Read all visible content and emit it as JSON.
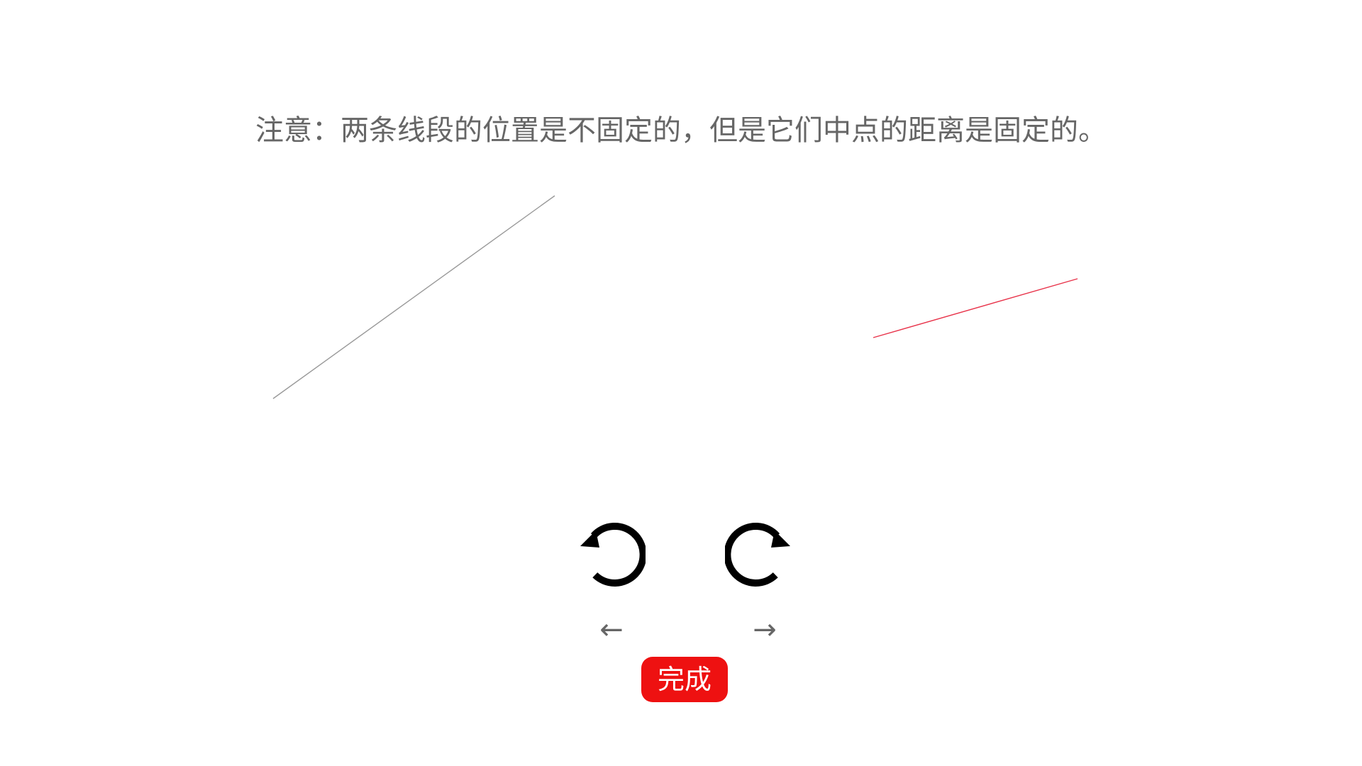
{
  "instruction": {
    "text": "注意：两条线段的位置是不固定的，但是它们中点的距离是固定的。"
  },
  "colors": {
    "instruction_text": "#666666",
    "reference_line": "#999999",
    "adjustable_line": "#e8334a",
    "rotate_icon": "#000000",
    "arrow_text": "#666666",
    "done_button_bg": "#ee1111",
    "done_button_text": "#ffffff"
  },
  "lines": [
    {
      "name": "reference-line",
      "role": "reference",
      "color": "#999999"
    },
    {
      "name": "adjustable-line",
      "role": "adjustable",
      "color": "#e8334a"
    }
  ],
  "controls": {
    "rotate_left_icon": "rotate-counterclockwise-icon",
    "rotate_right_icon": "rotate-clockwise-icon",
    "arrow_left": "←",
    "arrow_right": "→",
    "done_label": "完成"
  }
}
